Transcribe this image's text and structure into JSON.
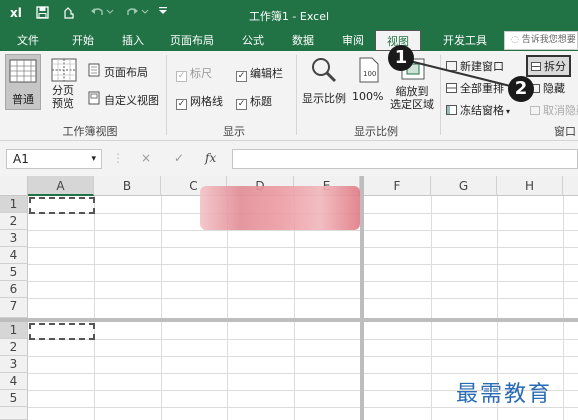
{
  "titlebar": {
    "app_icon": "xl",
    "title": "工作簿1 - Excel",
    "save_icon": "save-icon",
    "undo_icon": "undo-icon",
    "redo_icon": "redo-icon"
  },
  "tabs": [
    {
      "label": "文件"
    },
    {
      "label": "开始"
    },
    {
      "label": "插入"
    },
    {
      "label": "页面布局"
    },
    {
      "label": "公式"
    },
    {
      "label": "数据"
    },
    {
      "label": "审阅"
    },
    {
      "label": "视图"
    },
    {
      "label": "开发工具"
    }
  ],
  "tellme": {
    "placeholder": "告诉我您想要"
  },
  "ribbon": {
    "views_group": {
      "label": "工作簿视图",
      "normal": "普通",
      "page_break": "分页\n预览",
      "page_layout": "页面布局",
      "custom_views": "自定义视图"
    },
    "show_group": {
      "label": "显示",
      "ruler": "标尺",
      "formula_bar": "编辑栏",
      "gridlines": "网格线",
      "headings": "标题"
    },
    "zoom_group": {
      "label": "显示比例",
      "zoom": "显示比例",
      "zoom100": "100%",
      "zoom_selection": "缩放到\n选定区域"
    },
    "window_group": {
      "label": "窗口",
      "new_window": "新建窗口",
      "arrange_all": "全部重排",
      "freeze_panes": "冻结窗格",
      "split": "拆分",
      "hide": "隐藏",
      "unhide": "取消隐藏"
    }
  },
  "formula_bar": {
    "name_box": "A1",
    "cancel": "×",
    "enter": "✓",
    "fx": "fx"
  },
  "grid": {
    "columns": [
      "A",
      "B",
      "C",
      "D",
      "E",
      "F",
      "G",
      "H"
    ],
    "rows_top": [
      "1",
      "2",
      "3",
      "4",
      "5",
      "6",
      "7"
    ],
    "rows_bottom": [
      "1",
      "2",
      "3",
      "4",
      "5"
    ]
  },
  "callouts": {
    "one": "1",
    "two": "2"
  },
  "watermark": "最需教育"
}
